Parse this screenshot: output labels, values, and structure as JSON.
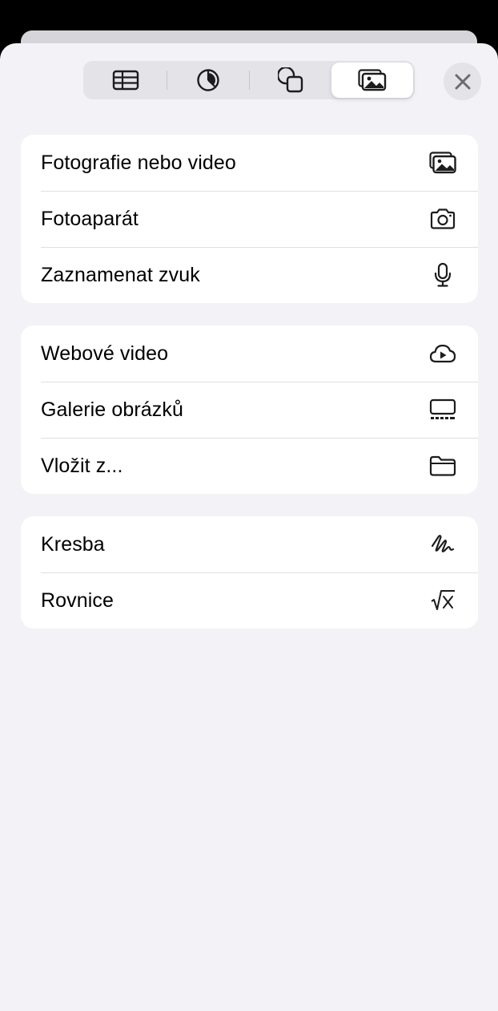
{
  "tabs": [
    {
      "icon": "table-icon",
      "active": false
    },
    {
      "icon": "chart-icon",
      "active": false
    },
    {
      "icon": "shapes-icon",
      "active": false
    },
    {
      "icon": "media-icon",
      "active": true
    }
  ],
  "close_icon": "close-icon",
  "groups": [
    {
      "items": [
        {
          "label": "Fotografie nebo video",
          "icon": "photos-icon"
        },
        {
          "label": "Fotoaparát",
          "icon": "camera-icon"
        },
        {
          "label": "Zaznamenat zvuk",
          "icon": "microphone-icon"
        }
      ]
    },
    {
      "items": [
        {
          "label": "Webové video",
          "icon": "cloud-play-icon"
        },
        {
          "label": "Galerie obrázků",
          "icon": "gallery-icon"
        },
        {
          "label": "Vložit z...",
          "icon": "folder-icon"
        }
      ]
    },
    {
      "items": [
        {
          "label": "Kresba",
          "icon": "drawing-icon"
        },
        {
          "label": "Rovnice",
          "icon": "equation-icon"
        }
      ]
    }
  ],
  "colors": {
    "sheet_background": "#f2f2f7",
    "card_background": "#ffffff",
    "segmented_background": "#e3e3e8",
    "text": "#000000",
    "icon": "#1c1c1e"
  }
}
